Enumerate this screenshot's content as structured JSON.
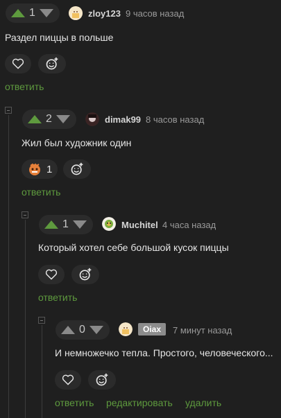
{
  "comments": [
    {
      "votes": "1",
      "user": "zloy123",
      "time": "9 часов назад",
      "text": "Раздел пиццы в польше",
      "reply": "ответить"
    },
    {
      "votes": "2",
      "user": "dimak99",
      "time": "8 часов назад",
      "text": "Жил был художник один",
      "reaction_count": "1",
      "reply": "ответить"
    },
    {
      "votes": "1",
      "user": "Muchitel",
      "time": "4 часа назад",
      "text": "Который хотел себе большой кусок пиццы",
      "reply": "ответить"
    },
    {
      "votes": "0",
      "user": "Oiax",
      "time": "7 минут назад",
      "text": "И немножечко тепла. Простого, человеческого...",
      "reply": "ответить",
      "edit": "редактировать",
      "delete": "удалить"
    }
  ],
  "colors": {
    "accent": "#5e9a3e",
    "background": "#1f1f1f",
    "pill": "#2b2b2b"
  }
}
